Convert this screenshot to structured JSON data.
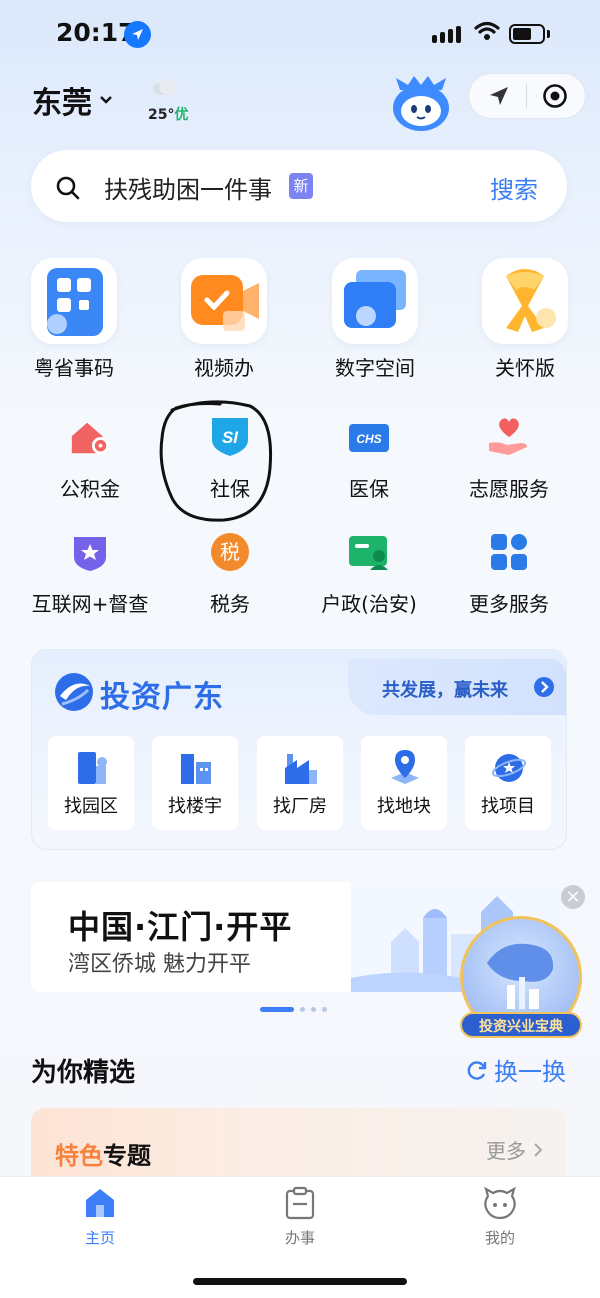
{
  "status_bar": {
    "time": "20:17"
  },
  "header": {
    "city": "东莞",
    "temperature": "25°",
    "air_quality": "优"
  },
  "search": {
    "text": "扶残助困一件事",
    "badge": "新",
    "button_label": "搜索"
  },
  "featured_tiles": [
    {
      "label": "粤省事码",
      "icon": "qr-code-icon"
    },
    {
      "label": "视频办",
      "icon": "video-camera-icon"
    },
    {
      "label": "数字空间",
      "icon": "digital-space-icon"
    },
    {
      "label": "关怀版",
      "icon": "care-ribbon-icon"
    }
  ],
  "services_row1": [
    {
      "label": "公积金",
      "icon": "housing-fund-icon"
    },
    {
      "label": "社保",
      "icon": "social-security-icon",
      "icon_text": "SI"
    },
    {
      "label": "医保",
      "icon": "medical-insurance-icon",
      "icon_text": "CHS"
    },
    {
      "label": "志愿服务",
      "icon": "volunteer-heart-icon"
    }
  ],
  "services_row2": [
    {
      "label": "互联网+督查",
      "icon": "shield-star-icon"
    },
    {
      "label": "税务",
      "icon": "tax-icon",
      "icon_text": "税"
    },
    {
      "label": "户政(治安)",
      "icon": "household-id-icon"
    },
    {
      "label": "更多服务",
      "icon": "grid-more-icon"
    }
  ],
  "invest": {
    "title": "投资广东",
    "slogan": "共发展，赢未来",
    "items": [
      {
        "label": "找园区",
        "icon": "park-building-icon"
      },
      {
        "label": "找楼宇",
        "icon": "office-building-icon"
      },
      {
        "label": "找厂房",
        "icon": "factory-icon"
      },
      {
        "label": "找地块",
        "icon": "land-pin-icon"
      },
      {
        "label": "找项目",
        "icon": "project-globe-icon"
      }
    ]
  },
  "banner": {
    "title": "中国·江门·开平",
    "subtitle": "湾区侨城 魅力开平",
    "badge_label": "投资兴业宝典"
  },
  "picks": {
    "title": "为你精选",
    "refresh_label": "换一换"
  },
  "topic": {
    "title_highlight": "特色",
    "title_rest": "专题",
    "more_label": "更多"
  },
  "tabbar": {
    "tabs": [
      {
        "label": "主页",
        "icon": "home-icon",
        "active": true
      },
      {
        "label": "办事",
        "icon": "clipboard-icon",
        "active": false
      },
      {
        "label": "我的",
        "icon": "profile-face-icon",
        "active": false
      }
    ]
  },
  "colors": {
    "accent": "#3b7ef7",
    "invest_blue": "#2d6ee8",
    "highlight_orange": "#f7823c",
    "annotation_ink": "#111111"
  }
}
